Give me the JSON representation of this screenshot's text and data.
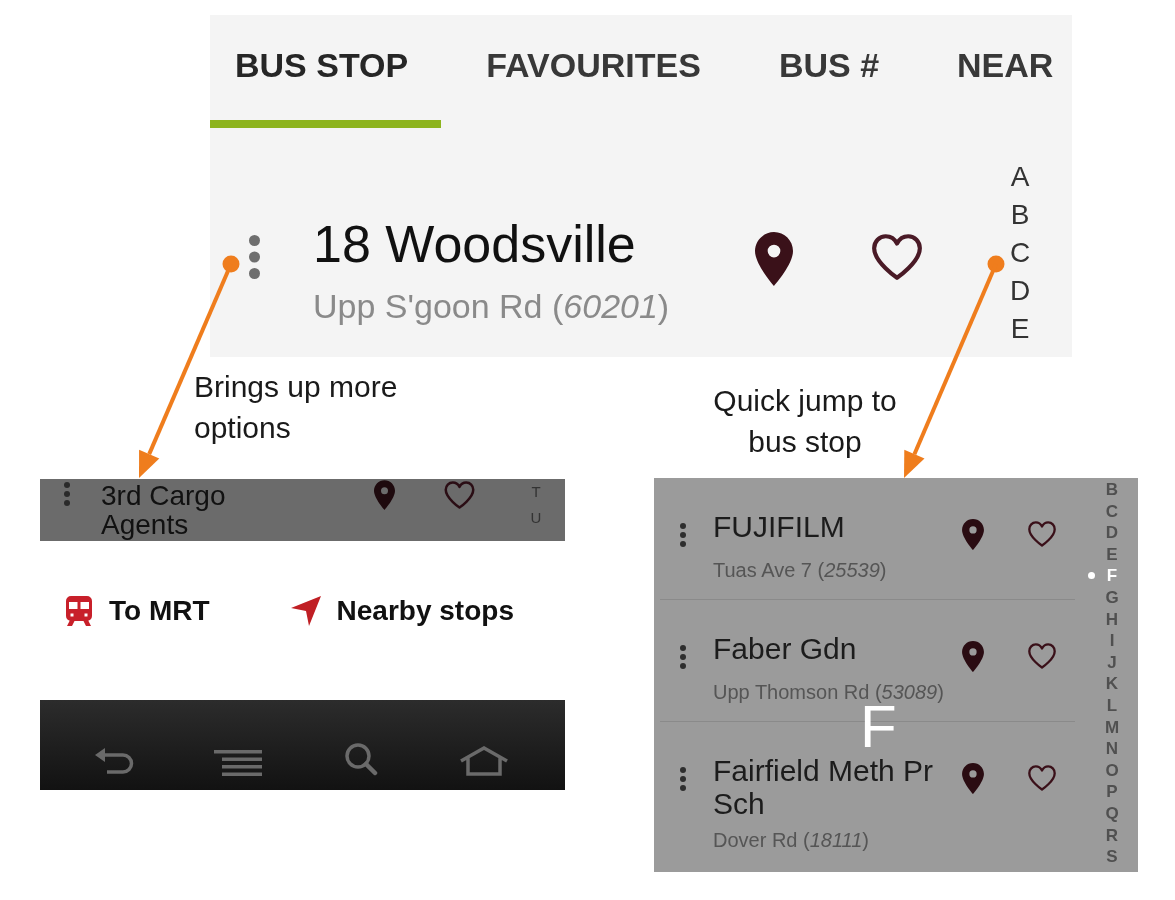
{
  "top_screen": {
    "tabs": [
      {
        "label": "BUS STOP",
        "selected": true
      },
      {
        "label": "FAVOURITES",
        "selected": false
      },
      {
        "label": "BUS #",
        "selected": false
      },
      {
        "label": "NEAR",
        "selected": false
      }
    ],
    "stop": {
      "name": "18 Woodsville",
      "subtitle": "Upp S'goon Rd (*60201*)"
    },
    "index_letters": [
      {
        "letter": "A",
        "selected": false
      },
      {
        "letter": "B",
        "selected": false
      },
      {
        "letter": "C",
        "selected": false
      },
      {
        "letter": "D",
        "selected": false
      },
      {
        "letter": "E",
        "selected": false
      }
    ]
  },
  "callouts": [
    {
      "text": "Brings up more options"
    },
    {
      "text": "Quick jump to bus stop"
    }
  ],
  "options_screen": {
    "stop": {
      "name": "3rd Cargo Agents"
    },
    "index_letters": [
      {
        "letter": "T",
        "selected": false
      },
      {
        "letter": "U",
        "selected": false
      }
    ],
    "actions": [
      {
        "label": "To MRT"
      },
      {
        "label": "Nearby stops"
      }
    ]
  },
  "index_screen": {
    "stops": [
      {
        "name": "FUJIFILM",
        "subtitle": "Tuas Ave 7 (*25539*)"
      },
      {
        "name": "Faber Gdn",
        "subtitle": "Upp Thomson Rd (*53089*)"
      },
      {
        "name": "Fairfield Meth Pr Sch",
        "subtitle": "Dover Rd (*18111*)"
      }
    ],
    "index_letters": [
      {
        "letter": "B",
        "selected": false
      },
      {
        "letter": "C",
        "selected": false
      },
      {
        "letter": "D",
        "selected": false
      },
      {
        "letter": "E",
        "selected": false
      },
      {
        "letter": "F",
        "selected": true
      },
      {
        "letter": "G",
        "selected": false
      },
      {
        "letter": "H",
        "selected": false
      },
      {
        "letter": "I",
        "selected": false
      },
      {
        "letter": "J",
        "selected": false
      },
      {
        "letter": "K",
        "selected": false
      },
      {
        "letter": "L",
        "selected": false
      },
      {
        "letter": "M",
        "selected": false
      },
      {
        "letter": "N",
        "selected": false
      },
      {
        "letter": "O",
        "selected": false
      },
      {
        "letter": "P",
        "selected": false
      },
      {
        "letter": "Q",
        "selected": false
      },
      {
        "letter": "R",
        "selected": false
      },
      {
        "letter": "S",
        "selected": false
      }
    ],
    "jump_letter": "F"
  }
}
